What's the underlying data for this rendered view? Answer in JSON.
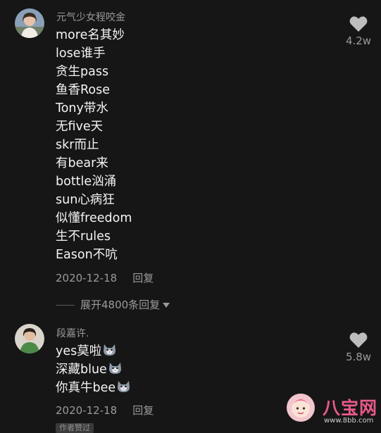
{
  "comments": [
    {
      "username": "元气少女程咬金",
      "lines": [
        "more名其妙",
        "lose谁手",
        "贪生pass",
        "鱼香Rose",
        "Tony带水",
        "无five天",
        "skr而止",
        "有bear来",
        "bottle汹涌",
        "sun心病狂",
        "似懂freedom",
        "生不rules",
        "Eason不吭"
      ],
      "date": "2020-12-18",
      "reply_label": "回复",
      "likes": "4.2w",
      "expand_label": "展开4800条回复"
    },
    {
      "username": "段嘉许.",
      "lines": [
        "yes莫啦",
        "深藏blue",
        "你真牛bee"
      ],
      "date": "2020-12-18",
      "reply_label": "回复",
      "likes": "5.8w",
      "author_tag": "作者赞过"
    }
  ],
  "icons": {
    "like": "heart-icon",
    "emoji": "cat-face-emoji-icon",
    "expand": "chevron-down-icon"
  },
  "watermark": {
    "brand": "八宝网",
    "url": "www.8bb.com"
  },
  "colors": {
    "background": "#161616",
    "primary_text": "#f4f4f4",
    "secondary_text": "#9a9a9a",
    "watermark_pink": "#e85a8a"
  }
}
